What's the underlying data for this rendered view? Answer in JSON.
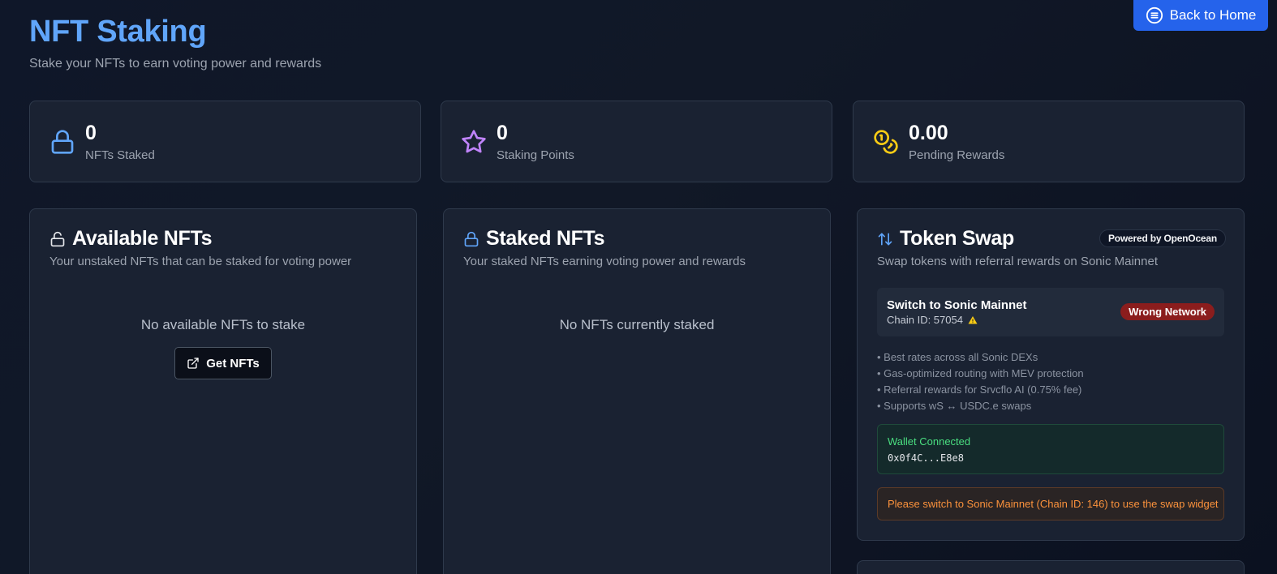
{
  "header": {
    "title": "NFT Staking",
    "subtitle": "Stake your NFTs to earn voting power and rewards",
    "back_button": "Back to Home"
  },
  "stats": [
    {
      "value": "0",
      "label": "NFTs Staked",
      "icon": "lock-icon",
      "color": "#60a5fa"
    },
    {
      "value": "0",
      "label": "Staking Points",
      "icon": "star-icon",
      "color": "#c084fc"
    },
    {
      "value": "0.00",
      "label": "Pending Rewards",
      "icon": "coins-icon",
      "color": "#facc15"
    }
  ],
  "available": {
    "title": "Available NFTs",
    "description": "Your unstaked NFTs that can be staked for voting power",
    "empty": "No available NFTs to stake",
    "button": "Get NFTs"
  },
  "staked": {
    "title": "Staked NFTs",
    "description": "Your staked NFTs earning voting power and rewards",
    "empty": "No NFTs currently staked"
  },
  "swap": {
    "title": "Token Swap",
    "powered_by": "Powered by OpenOcean",
    "description": "Swap tokens with referral rewards on Sonic Mainnet",
    "network": {
      "title": "Switch to Sonic Mainnet",
      "chain": "Chain ID: 57054",
      "badge": "Wrong Network"
    },
    "features": [
      "Best rates across all Sonic DEXs",
      "Gas-optimized routing with MEV protection",
      "Referral rewards for Srvcflo AI (0.75% fee)",
      "Supports wS ↔ USDC.e swaps"
    ],
    "wallet": {
      "label": "Wallet Connected",
      "address": "0x0f4C...E8e8"
    },
    "switch_notice": "Please switch to Sonic Mainnet (Chain ID: 146) to use the swap widget"
  },
  "colors": {
    "accent": "#2563eb",
    "title": "#60a5fa",
    "success": "#4ade80",
    "danger": "#8b1d1d",
    "warning": "#fb923c"
  }
}
